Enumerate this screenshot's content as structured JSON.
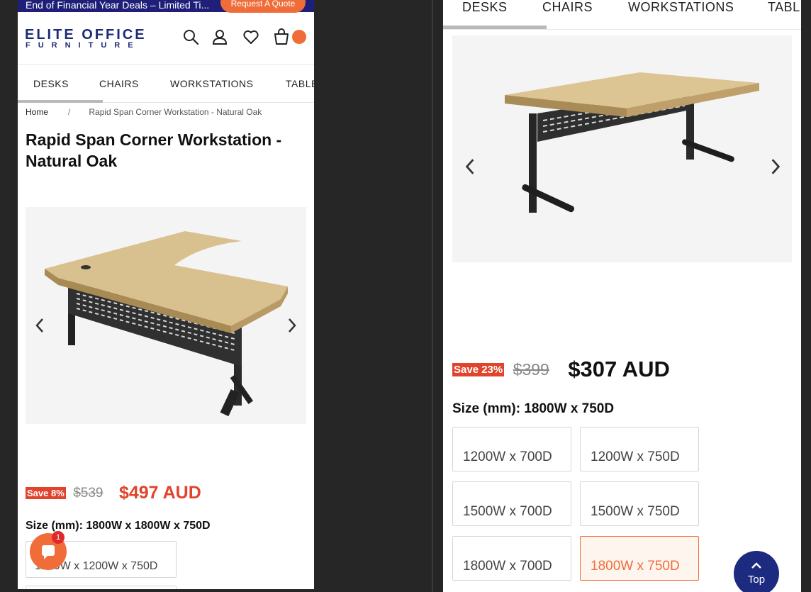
{
  "left": {
    "promo": {
      "text": "End of Financial Year Deals – Limited Ti...",
      "quote_label": "Request A Quote"
    },
    "brand": {
      "line1": "ELITE OFFICE",
      "line2": "FURNITURE"
    },
    "nav": [
      "DESKS",
      "CHAIRS",
      "WORKSTATIONS",
      "TABLE"
    ],
    "breadcrumb": {
      "home": "Home",
      "separator": "/",
      "current": "Rapid Span Corner Workstation - Natural Oak"
    },
    "title": "Rapid Span Corner Workstation - Natural Oak",
    "price": {
      "save": "Save 8%",
      "old": "$539",
      "new": "$497 AUD"
    },
    "size_label": "Size (mm): 1800W x 1800W x 750D",
    "options": [
      "1200W x 1200W x 750D"
    ],
    "chat_badge": "1",
    "icons": [
      "search-icon",
      "account-icon",
      "heart-icon",
      "cart-icon",
      "chevron-left-icon",
      "chevron-right-icon",
      "chat-icon"
    ]
  },
  "right": {
    "nav": [
      "DESKS",
      "CHAIRS",
      "WORKSTATIONS",
      "TABLE"
    ],
    "price": {
      "save": "Save 23%",
      "old": "$399",
      "new": "$307 AUD"
    },
    "size_label": "Size (mm): 1800W x 750D",
    "options": [
      "1200W x 700D",
      "1200W x 750D",
      "1500W x 700D",
      "1500W x 750D",
      "1800W x 700D",
      "1800W x 750D"
    ],
    "selected_option": "1800W x 750D",
    "top_label": "Top"
  },
  "colors": {
    "brand_navy": "#1f2a78",
    "accent_orange": "#f06d3a",
    "sale_red": "#e0442c"
  }
}
